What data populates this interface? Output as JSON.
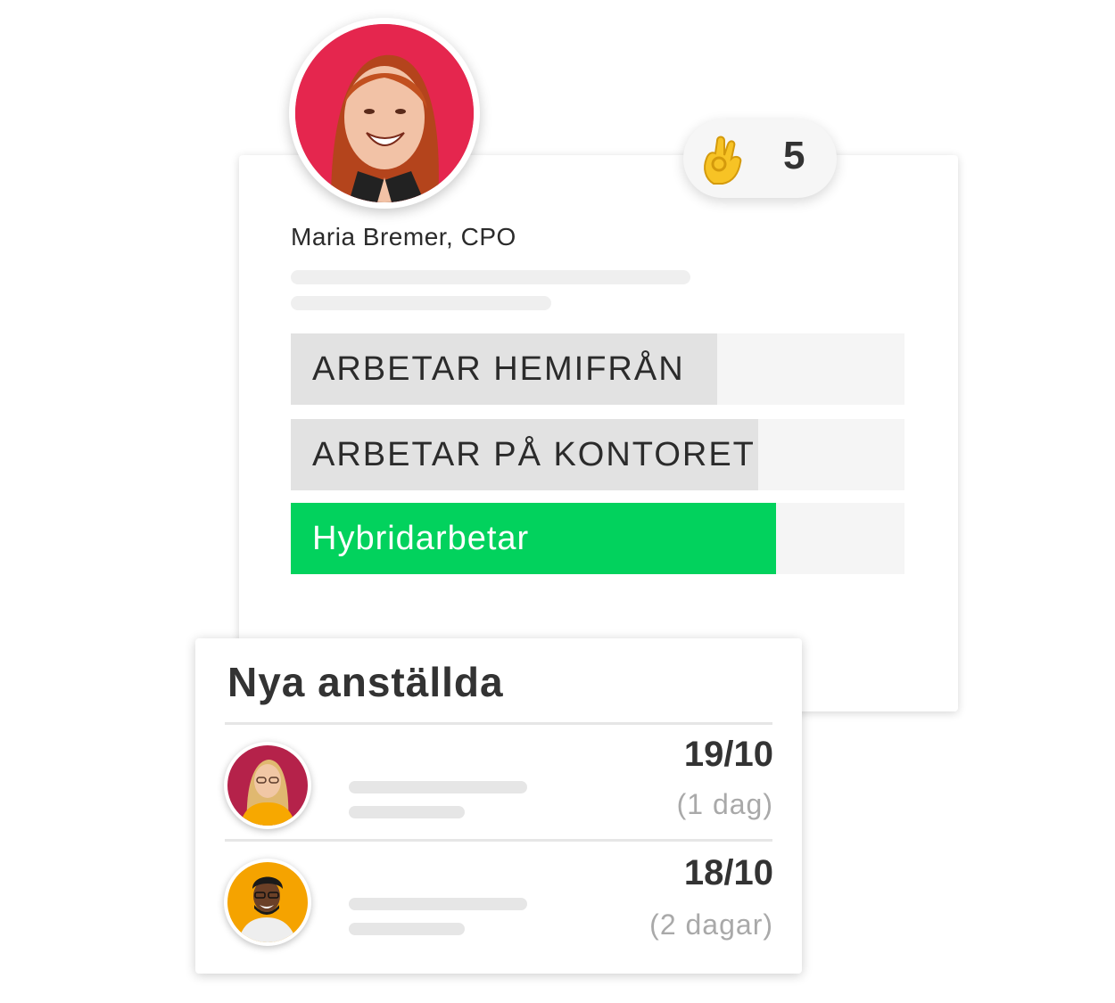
{
  "poll": {
    "author_name": "Maria Bremer, CPO",
    "author_avatar_icon": "woman-smiling-avatar",
    "reaction": {
      "emoji": "ok-hand-icon",
      "count": "5"
    },
    "options": [
      {
        "label": "ARBETAR HEMIFRÅN",
        "fill_fraction": 0.69,
        "selected": false
      },
      {
        "label": "ARBETAR PÅ KONTORET",
        "fill_fraction": 0.76,
        "selected": false
      },
      {
        "label": "Hybridarbetar",
        "fill_fraction": 0.79,
        "selected": true
      }
    ],
    "colors": {
      "selected": "#02d25d",
      "bar": "#e2e2e2",
      "author_bg": "#e5264e"
    }
  },
  "new_hires": {
    "title": "Nya anställda",
    "items": [
      {
        "date": "19/10",
        "relative": "(1 dag)",
        "avatar_icon": "woman-avatar",
        "avatar_bg": "#b5224a"
      },
      {
        "date": "18/10",
        "relative": "(2 dagar)",
        "avatar_icon": "man-avatar",
        "avatar_bg": "#f5a300"
      }
    ]
  }
}
